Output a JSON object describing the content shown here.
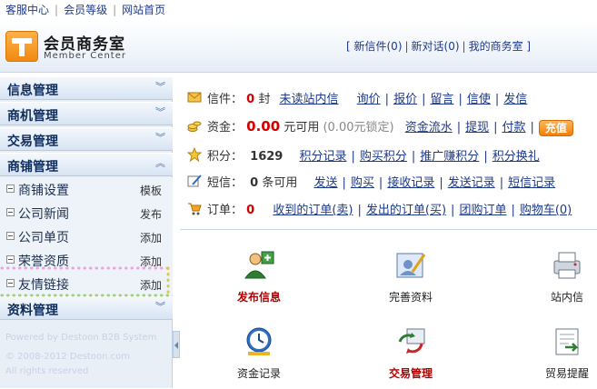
{
  "topbar": {
    "links": [
      "客服中心",
      "会员等级",
      "网站首页"
    ]
  },
  "header": {
    "brand": "会员商务室",
    "brand_sub": "Member Center",
    "links": [
      "新信件(0)",
      "新对话(0)",
      "我的商务室"
    ]
  },
  "sidebar": {
    "sections": [
      "信息管理",
      "商机管理",
      "交易管理",
      "商铺管理",
      "资料管理"
    ],
    "subitems": [
      {
        "label": "商铺设置",
        "action": "模板"
      },
      {
        "label": "公司新闻",
        "action": "发布"
      },
      {
        "label": "公司单页",
        "action": "添加"
      },
      {
        "label": "荣誉资质",
        "action": "添加"
      },
      {
        "label": "友情链接",
        "action": "添加"
      }
    ],
    "footer": [
      "Powered by Destoon B2B System",
      "© 2008-2012 Destoon.com",
      "All rights reserved"
    ]
  },
  "main": {
    "letters": {
      "label": "信件：",
      "count": "0",
      "unit": "封",
      "links": [
        "未读站内信",
        "询价",
        "报价",
        "留言",
        "信使",
        "发信"
      ]
    },
    "funds": {
      "label": "资金：",
      "amount": "0.00",
      "unit": "元可用",
      "locked": "(0.00元锁定)",
      "links": [
        "资金流水",
        "提现",
        "付款"
      ],
      "button": "充值"
    },
    "points": {
      "label": "积分：",
      "count": "1629",
      "links": [
        "积分记录",
        "购买积分",
        "推广赚积分",
        "积分换礼"
      ]
    },
    "sms": {
      "label": "短信：",
      "count": "0",
      "unit": "条可用",
      "links": [
        "发送",
        "购买",
        "接收记录",
        "发送记录",
        "短信记录"
      ]
    },
    "orders": {
      "label": "订单：",
      "count": "0",
      "links": [
        "收到的订单(卖)",
        "发出的订单(买)",
        "团购订单",
        "购物车(0)"
      ]
    }
  },
  "tiles": [
    {
      "label": "发布信息",
      "icon": "publish-icon"
    },
    {
      "label": "完善资料",
      "icon": "edit-profile-icon"
    },
    {
      "label": "站内信",
      "icon": "printer-icon"
    },
    {
      "label": "资金记录",
      "icon": "clock-icon"
    },
    {
      "label": "交易管理",
      "icon": "trade-icon"
    },
    {
      "label": "贸易提醒",
      "icon": "reminder-icon"
    }
  ],
  "colors": {
    "accent": "#f08a12",
    "link": "#1e3a8a",
    "alert": "#d40000"
  }
}
